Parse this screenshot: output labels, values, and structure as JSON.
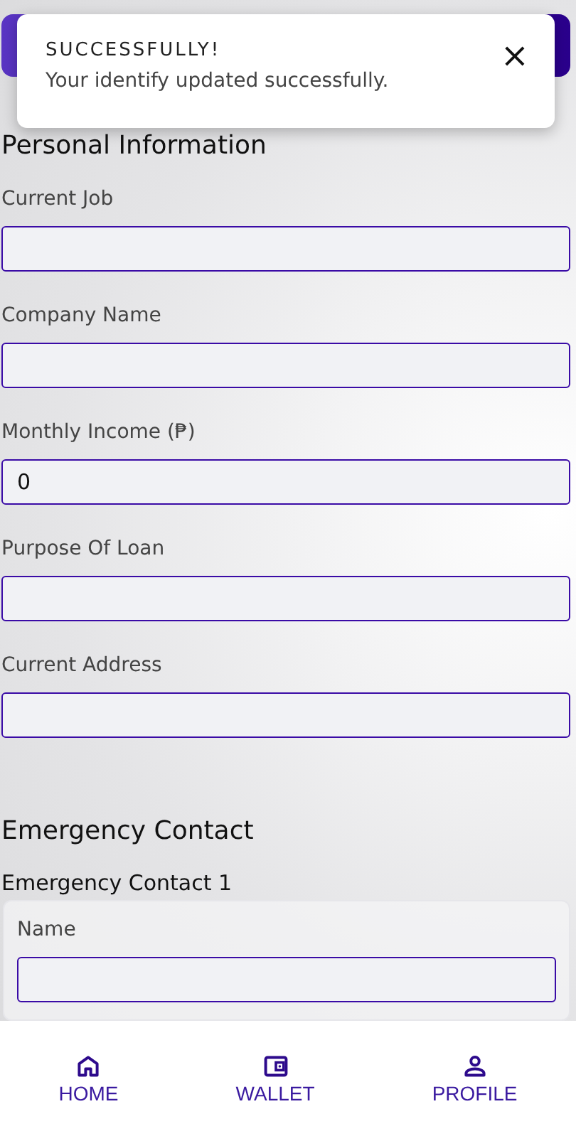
{
  "toast": {
    "title": "SUCCESSFULLY!",
    "message": "Your identify updated successfully.",
    "close": "×"
  },
  "personal": {
    "title": "Personal Information",
    "fields": [
      {
        "label": "Current Job"
      },
      {
        "label": "Company Name"
      },
      {
        "label": "Monthly Income (₱)",
        "value": "0"
      },
      {
        "label": "Purpose Of Loan"
      },
      {
        "label": "Current Address"
      }
    ]
  },
  "emergency": {
    "title": "Emergency Contact",
    "contacts": [
      {
        "title": "Emergency Contact 1",
        "fields": [
          {
            "label": "Name"
          }
        ]
      }
    ]
  },
  "nav": [
    {
      "label": "HOME",
      "kind": "home"
    },
    {
      "label": "WALLET",
      "kind": "wallet"
    },
    {
      "label": "PROFILE",
      "kind": "profile"
    }
  ]
}
